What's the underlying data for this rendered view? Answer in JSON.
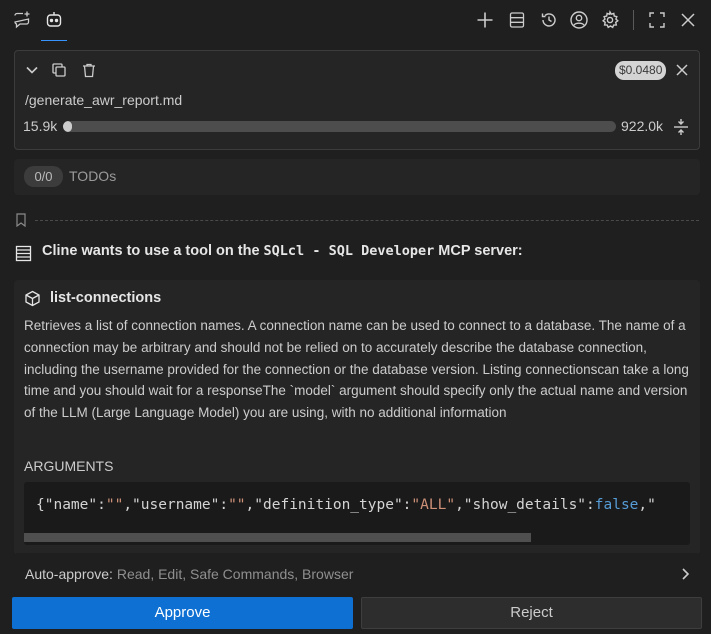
{
  "toolbar": {
    "left_icons": [
      "chat-plus-icon",
      "robot-icon"
    ],
    "right_icons": [
      "plus-icon",
      "server-icon",
      "history-icon",
      "account-icon",
      "gear-icon",
      "fullscreen-icon",
      "close-icon"
    ]
  },
  "task": {
    "title": "/generate_awr_report.md",
    "cost": "$0.0480",
    "context_used": "15.9k",
    "context_total": "922.0k",
    "context_fraction": 0.017
  },
  "todos": {
    "count": "0/0",
    "label": "TODOs"
  },
  "request": {
    "prefix": "Cline wants to use a tool on the ",
    "server": "SQLcl - SQL Developer",
    "suffix": " MCP server:"
  },
  "tool": {
    "name": "list-connections",
    "description": "Retrieves a list of connection names. A connection name can be used to connect to a database. The name of a connection may be arbitrary and should not be relied on to accurately describe the database connection, including the username provided for the connection or the database version. Listing connectionscan take a long time and you should wait for a responseThe `model` argument should specify only the actual name and version of the LLM (Large Language Model) you are using, with no additional information",
    "arguments_label": "ARGUMENTS",
    "arguments": {
      "name": "\"\"",
      "username": "\"\"",
      "definition_type": "\"ALL\"",
      "show_details": "false"
    }
  },
  "auto_approve": {
    "label": "Auto-approve:",
    "value": "Read, Edit, Safe Commands, Browser"
  },
  "actions": {
    "approve": "Approve",
    "reject": "Reject"
  },
  "colors": {
    "accent": "#3794ff",
    "approve_button": "#0e70d3",
    "string_token": "#ce9178",
    "keyword_token": "#569cd6"
  }
}
